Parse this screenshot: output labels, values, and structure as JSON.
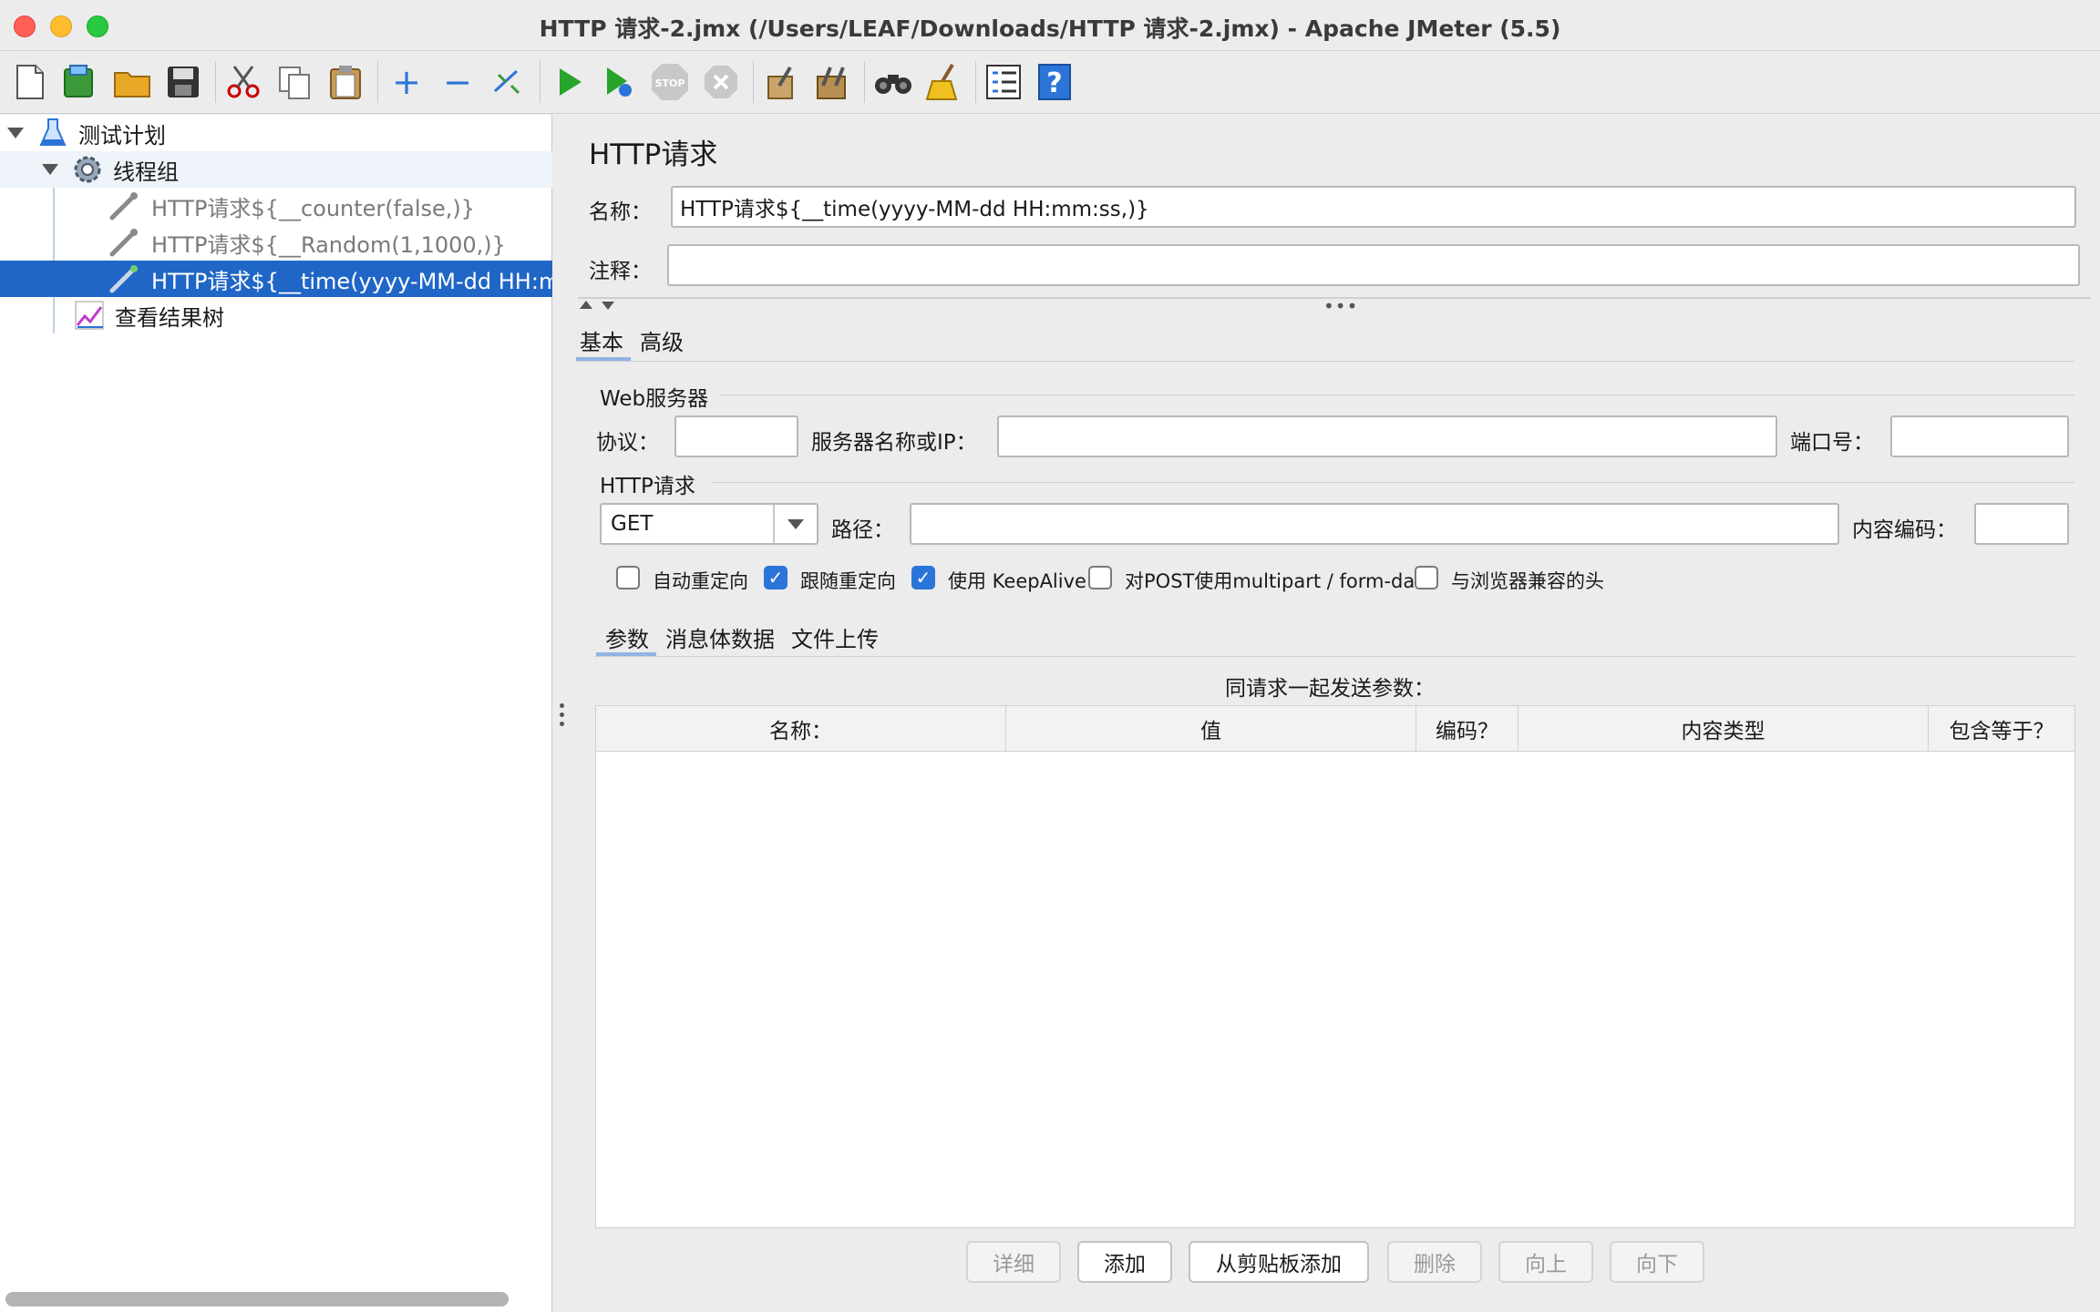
{
  "window": {
    "title": "HTTP 请求-2.jmx (/Users/LEAF/Downloads/HTTP 请求-2.jmx) - Apache JMeter (5.5)"
  },
  "toolbar": {
    "icons": [
      "new-icon",
      "templates-icon",
      "open-icon",
      "save-icon",
      "cut-icon",
      "copy-icon",
      "paste-icon",
      "expand-icon",
      "collapse-icon",
      "toggle-icon",
      "start-icon",
      "start-no-pause-icon",
      "stop-icon",
      "shutdown-icon",
      "clear-icon",
      "clear-all-icon",
      "search-icon",
      "reset-search-icon",
      "function-helper-icon",
      "help-icon"
    ]
  },
  "tree": {
    "items": [
      {
        "label": "测试计划"
      },
      {
        "label": "线程组"
      },
      {
        "label": "HTTP请求${__counter(false,)}"
      },
      {
        "label": "HTTP请求${__Random(1,1000,)}"
      },
      {
        "label": "HTTP请求${__time(yyyy-MM-dd HH:mm:ss,)}"
      },
      {
        "label": "查看结果树"
      }
    ]
  },
  "panel": {
    "heading": "HTTP请求",
    "name_label": "名称：",
    "name_value": "HTTP请求${__time(yyyy-MM-dd HH:mm:ss,)}",
    "comment_label": "注释：",
    "comment_value": "",
    "tabs": [
      {
        "label": "基本"
      },
      {
        "label": "高级"
      }
    ],
    "web_server": {
      "group_label": "Web服务器",
      "protocol_label": "协议：",
      "protocol_value": "",
      "server_label": "服务器名称或IP：",
      "server_value": "",
      "port_label": "端口号：",
      "port_value": ""
    },
    "http_request": {
      "group_label": "HTTP请求",
      "method": "GET",
      "path_label": "路径：",
      "path_value": "",
      "encoding_label": "内容编码：",
      "encoding_value": ""
    },
    "checkboxes": [
      {
        "label": "自动重定向",
        "checked": false
      },
      {
        "label": "跟随重定向",
        "checked": true
      },
      {
        "label": "使用 KeepAlive",
        "checked": true
      },
      {
        "label": "对POST使用multipart / form-data",
        "checked": false
      },
      {
        "label": "与浏览器兼容的头",
        "checked": false
      }
    ],
    "sub_tabs": [
      {
        "label": "参数"
      },
      {
        "label": "消息体数据"
      },
      {
        "label": "文件上传"
      }
    ],
    "params_caption": "同请求一起发送参数：",
    "table_headers": [
      "名称：",
      "值",
      "编码？",
      "内容类型",
      "包含等于？"
    ],
    "buttons": [
      {
        "label": "详细",
        "enabled": false
      },
      {
        "label": "添加",
        "enabled": true
      },
      {
        "label": "从剪贴板添加",
        "enabled": true
      },
      {
        "label": "删除",
        "enabled": false
      },
      {
        "label": "向上",
        "enabled": false
      },
      {
        "label": "向下",
        "enabled": false
      }
    ]
  },
  "colors": {
    "selection": "#2066c6",
    "checkbox_on": "#2b74d8",
    "tab_underline": "#8fb4e3"
  }
}
